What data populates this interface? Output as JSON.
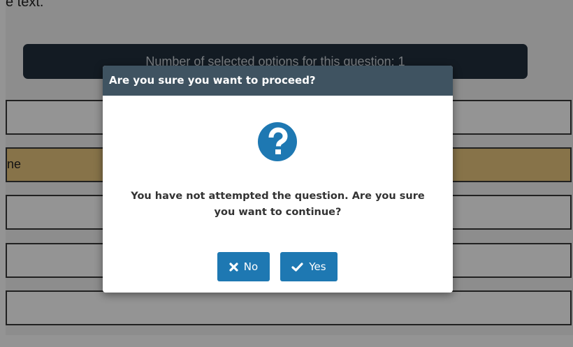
{
  "background": {
    "prompt_text": "e text.",
    "status_bar": "Number of selected options for this question: 1",
    "options": [
      {
        "text": ""
      },
      {
        "text": "ne",
        "selected": true
      },
      {
        "text": ""
      },
      {
        "text": ""
      },
      {
        "text": ""
      }
    ]
  },
  "dialog": {
    "title": "Are you sure you want to proceed?",
    "icon": "question-circle-icon",
    "message": "You have not attempted the question. Are you sure you want to continue?",
    "buttons": {
      "no": {
        "label": "No",
        "icon": "x-icon"
      },
      "yes": {
        "label": "Yes",
        "icon": "check-icon"
      }
    }
  },
  "colors": {
    "header": "#3f5361",
    "button": "#1e78b2",
    "icon": "#1e78b2",
    "selected_option": "#e9c67f",
    "status_bar": "#22303d"
  }
}
